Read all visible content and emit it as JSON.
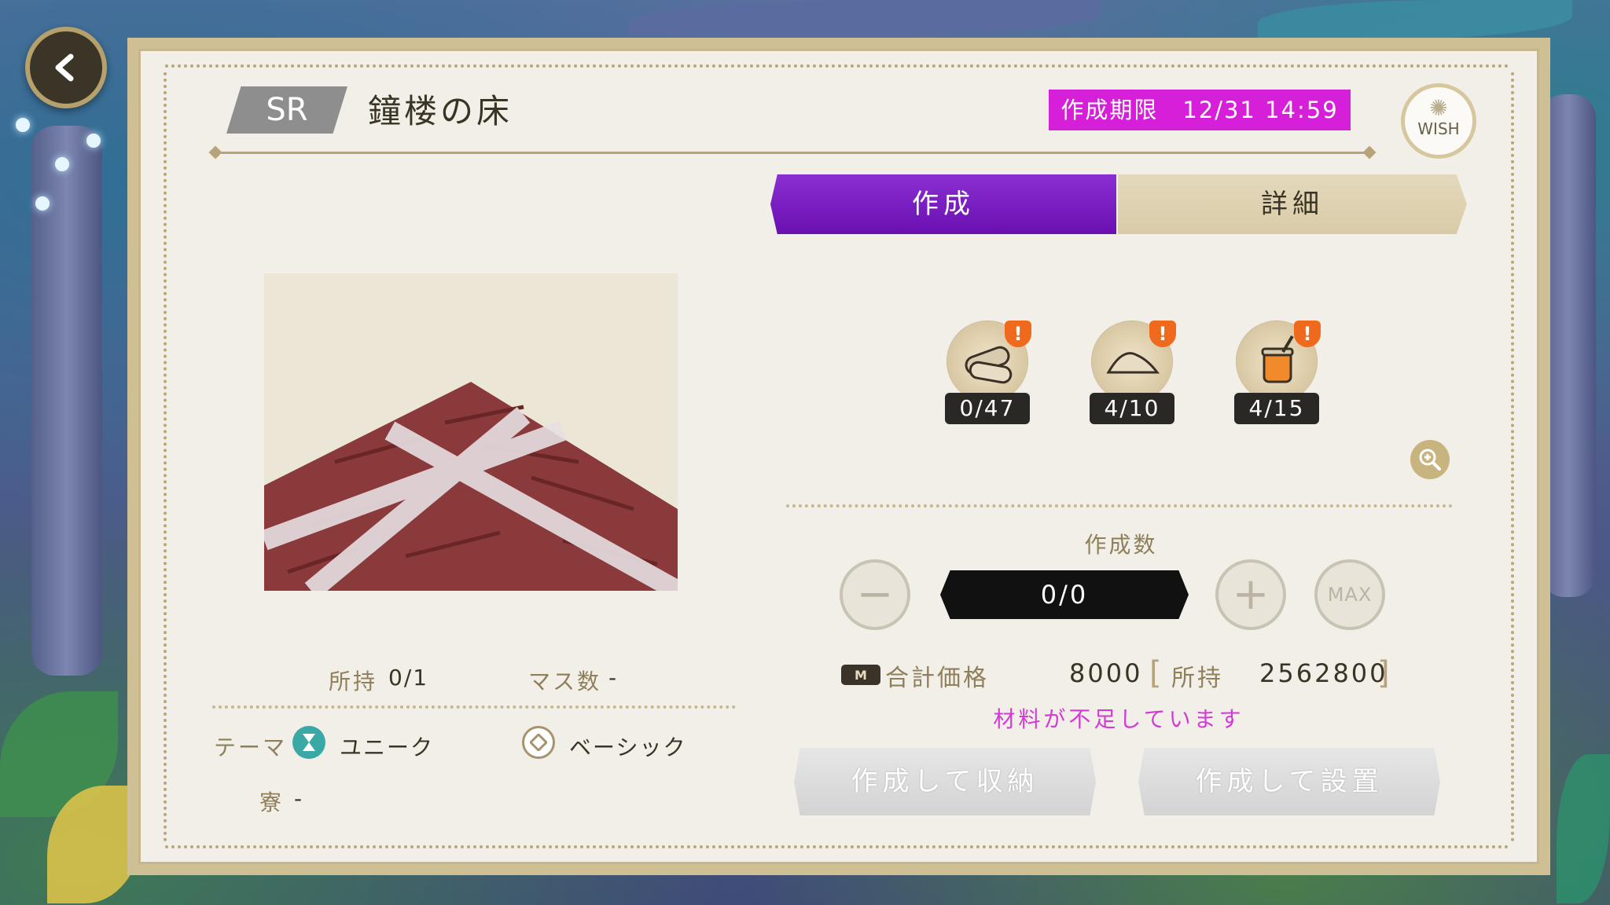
{
  "item": {
    "rarity": "SR",
    "name": "鐘楼の床"
  },
  "deadline": "作成期限　12/31 14:59",
  "wish_label": "WISH",
  "tabs": {
    "create": "作成",
    "detail": "詳細"
  },
  "info": {
    "own_label": "所持",
    "own_value": "0/1",
    "squares_label": "マス数",
    "squares_value": "-",
    "theme_label": "テーマ",
    "themes": [
      {
        "icon": "hourglass-icon",
        "label": "ユニーク"
      },
      {
        "icon": "diamond-icon",
        "label": "ベーシック"
      }
    ],
    "dorm_label": "寮",
    "dorm_value": "-"
  },
  "materials": [
    {
      "icon": "log-icon",
      "count": "0/47"
    },
    {
      "icon": "sand-pile-icon",
      "count": "4/10"
    },
    {
      "icon": "paint-jar-icon",
      "count": "4/15"
    }
  ],
  "quantity": {
    "label": "作成数",
    "value": "0/0",
    "minus": "−",
    "plus": "+",
    "max": "MAX"
  },
  "price": {
    "label": "合計価格",
    "value": "8000",
    "own_label": "所持",
    "own_value": "2562800",
    "open_bracket": "[",
    "close_bracket": "]"
  },
  "warning": "材料が不足しています",
  "actions": {
    "store": "作成して収納",
    "place": "作成して設置"
  },
  "colors": {
    "accent_purple": "#7a1fc4",
    "deadline_magenta": "#d61fd8",
    "warning_magenta": "#d33ad6",
    "gold": "#c7b47f"
  }
}
